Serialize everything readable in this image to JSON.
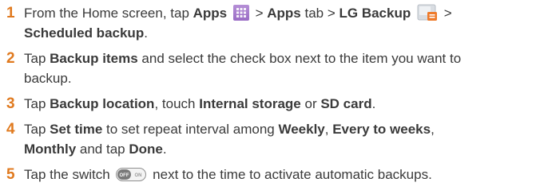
{
  "steps": [
    {
      "num": "1",
      "line1": {
        "t1": "From the Home screen, tap ",
        "b1": "Apps",
        "t2": " > ",
        "b2": "Apps",
        "t3": " tab > ",
        "b3": "LG Backup",
        "t4": " >"
      },
      "line2": {
        "b1": "Scheduled backup",
        "t1": "."
      }
    },
    {
      "num": "2",
      "line1": {
        "t1": "Tap ",
        "b1": "Backup items",
        "t2": " and select the check box next to the item you want to"
      },
      "line2": {
        "t1": "backup."
      }
    },
    {
      "num": "3",
      "line1": {
        "t1": "Tap ",
        "b1": "Backup location",
        "t2": ", touch ",
        "b2": "Internal storage",
        "t3": " or ",
        "b3": "SD card",
        "t4": "."
      }
    },
    {
      "num": "4",
      "line1": {
        "t1": "Tap ",
        "b1": "Set time",
        "t2": " to set repeat interval among ",
        "b2": "Weekly",
        "t3": ", ",
        "b3": "Every to weeks",
        "t4": ","
      },
      "line2": {
        "b1": "Monthly",
        "t1": " and tap ",
        "b2": "Done",
        "t2": "."
      }
    },
    {
      "num": "5",
      "line1": {
        "t1": "Tap the switch ",
        "t2": " next to the time to activate automatic backups."
      },
      "switch": {
        "off_label": "OFF",
        "on_label": "ON"
      }
    }
  ],
  "icons": {
    "apps": "apps-grid-icon",
    "lg_backup": "lg-backup-icon",
    "switch": "toggle-switch-icon"
  },
  "colors": {
    "step_number": "#e07a1f",
    "text": "#3a3a3a"
  }
}
